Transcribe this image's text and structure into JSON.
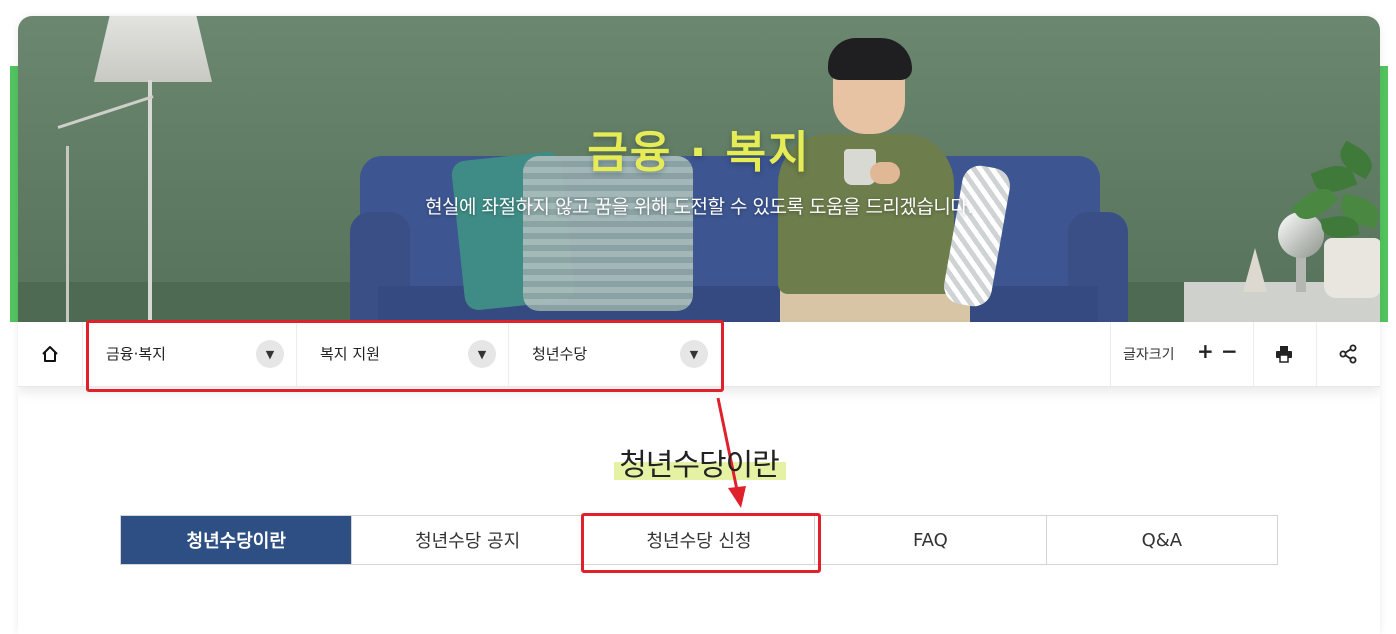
{
  "hero": {
    "title": "금융 · 복지",
    "subtitle": "현실에 좌절하지 않고 꿈을 위해 도전할 수 있도록 도움을 드리겠습니다."
  },
  "nav": {
    "breadcrumbs": [
      {
        "label": "금융·복지"
      },
      {
        "label": "복지 지원"
      },
      {
        "label": "청년수당"
      }
    ],
    "font_size_label": "글자크기",
    "font_plus": "+",
    "font_minus": "−"
  },
  "page": {
    "heading": "청년수당이란"
  },
  "tabs": [
    {
      "label": "청년수당이란",
      "active": true
    },
    {
      "label": "청년수당 공지",
      "active": false
    },
    {
      "label": "청년수당 신청",
      "active": false
    },
    {
      "label": "FAQ",
      "active": false
    },
    {
      "label": "Q&A",
      "active": false
    }
  ],
  "colors": {
    "brand_green": "#52c45f",
    "hero_title": "#e6ec56",
    "active_tab": "#2e4f83",
    "annotation_red": "#e0202a",
    "heading_highlight": "#e5f2a4"
  },
  "icons": [
    "home-icon",
    "chevron-down-icon",
    "print-icon",
    "share-icon"
  ]
}
